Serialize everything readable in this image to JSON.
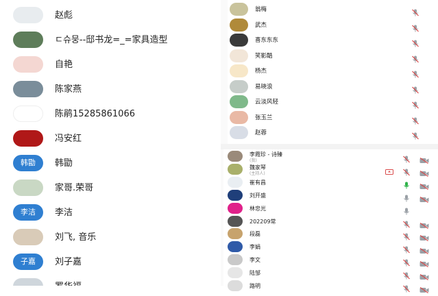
{
  "contacts": [
    {
      "name": "赵彪",
      "avatar_text": "",
      "avatar_color": "#e8ecef"
    },
    {
      "name": "ㄷ슈뭉--邸书龙=_=家具造型",
      "avatar_text": "",
      "avatar_color": "#5e7d5a"
    },
    {
      "name": "自艳",
      "avatar_text": "",
      "avatar_color": "#f4d7d2"
    },
    {
      "name": "陈家燕",
      "avatar_text": "",
      "avatar_color": "#7a8d9a"
    },
    {
      "name": "陈鹃15285861066",
      "avatar_text": "",
      "avatar_color": "#ffffff"
    },
    {
      "name": "冯安红",
      "avatar_text": "",
      "avatar_color": "#b01818"
    },
    {
      "name": "韩勖",
      "avatar_text": "韩勖",
      "avatar_color": "#2f7fd1"
    },
    {
      "name": "家哥.荣哥",
      "avatar_text": "",
      "avatar_color": "#c9d8c4"
    },
    {
      "name": "李洁",
      "avatar_text": "李洁",
      "avatar_color": "#2f7fd1"
    },
    {
      "name": "刘飞, 音乐",
      "avatar_text": "",
      "avatar_color": "#d9cbb8"
    },
    {
      "name": "刘子嘉",
      "avatar_text": "子嘉",
      "avatar_color": "#2f7fd1"
    },
    {
      "name": "罗华福",
      "avatar_text": "",
      "avatar_color": "#cfd6dc"
    }
  ],
  "participants_top": [
    {
      "name": "翁梅",
      "avatar_color": "#c9c39c"
    },
    {
      "name": "武杰",
      "avatar_color": "#b08a3a"
    },
    {
      "name": "喜东东东",
      "avatar_color": "#3a3a3a"
    },
    {
      "name": "笑影酷",
      "avatar_color": "#f2e6d8"
    },
    {
      "name": "杨杰",
      "avatar_color": "#f7e7c8"
    },
    {
      "name": "易晓浪",
      "avatar_color": "#c6cdc9"
    },
    {
      "name": "云淡风轻",
      "avatar_color": "#7fb98a"
    },
    {
      "name": "张玉兰",
      "avatar_color": "#e9b9a5"
    },
    {
      "name": "赵蓉",
      "avatar_color": "#d8dde6"
    }
  ],
  "participants_bottom": [
    {
      "name": "李霞珍 - 诗臻",
      "sub": "(我)",
      "avatar_color": "#9a8a7a",
      "mic": "muted",
      "extra": ""
    },
    {
      "name": "魏家琴",
      "sub": "(主持人)",
      "avatar_color": "#a9b06a",
      "mic": "muted",
      "extra": "share"
    },
    {
      "name": "崔有昌",
      "sub": "",
      "avatar_color": "#e9eef2",
      "mic": "active",
      "extra": ""
    },
    {
      "name": "刘开盛",
      "sub": "",
      "avatar_color": "#1f3f7a",
      "mic": "normal",
      "extra": ""
    },
    {
      "name": "林忠光",
      "sub": "",
      "avatar_color": "#e0218a",
      "mic": "normal-nocam",
      "extra": ""
    },
    {
      "name": "202209常",
      "sub": "",
      "avatar_color": "#555555",
      "mic": "muted",
      "extra": ""
    },
    {
      "name": "段磊",
      "sub": "",
      "avatar_color": "#c7a36d",
      "mic": "muted",
      "extra": ""
    },
    {
      "name": "李娟",
      "sub": "",
      "avatar_color": "#2f5aa8",
      "mic": "muted",
      "extra": ""
    },
    {
      "name": "李文",
      "sub": "",
      "avatar_color": "#c9c9c9",
      "mic": "muted",
      "extra": ""
    },
    {
      "name": "陆邹",
      "sub": "",
      "avatar_color": "#e6e6e6",
      "mic": "muted",
      "extra": ""
    },
    {
      "name": "路明",
      "sub": "",
      "avatar_color": "#dcdcdc",
      "mic": "muted",
      "extra": ""
    }
  ],
  "colors": {
    "muted_red": "#d94a4a",
    "active_green": "#2fb34a",
    "icon_gray": "#9aa0a6"
  }
}
